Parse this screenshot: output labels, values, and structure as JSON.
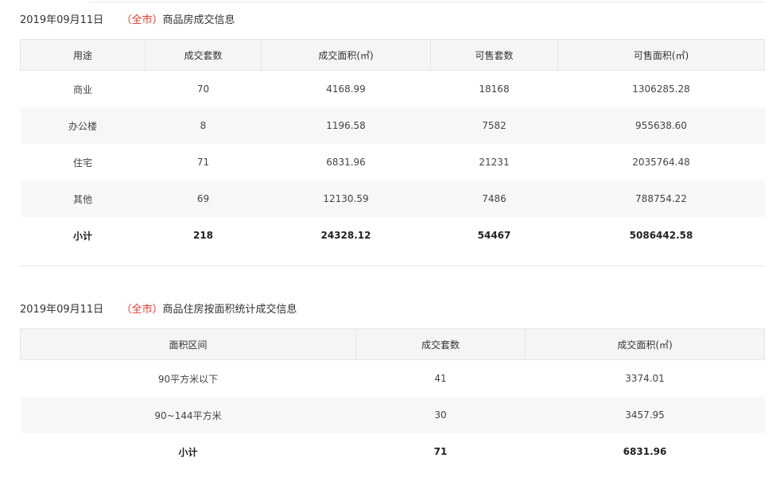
{
  "section1": {
    "date": "2019年09月11日",
    "open_paren": "（",
    "scope": "全市",
    "close_paren": "）",
    "title": "商品房成交信息",
    "headers": [
      "用途",
      "成交套数",
      "成交面积(㎡)",
      "可售套数",
      "可售面积(㎡)"
    ],
    "rows": [
      [
        "商业",
        "70",
        "4168.99",
        "18168",
        "1306285.28"
      ],
      [
        "办公楼",
        "8",
        "1196.58",
        "7582",
        "955638.60"
      ],
      [
        "住宅",
        "71",
        "6831.96",
        "21231",
        "2035764.48"
      ],
      [
        "其他",
        "69",
        "12130.59",
        "7486",
        "788754.22"
      ]
    ],
    "total": [
      "小计",
      "218",
      "24328.12",
      "54467",
      "5086442.58"
    ]
  },
  "section2": {
    "date": "2019年09月11日",
    "open_paren": "（",
    "scope": "全市",
    "close_paren": "）",
    "title": "商品住房按面积统计成交信息",
    "headers": [
      "面积区间",
      "成交套数",
      "成交面积(㎡)"
    ],
    "rows": [
      [
        "90平方米以下",
        "41",
        "3374.01"
      ],
      [
        "90~144平方米",
        "30",
        "3457.95"
      ]
    ],
    "total": [
      "小计",
      "71",
      "6831.96"
    ]
  },
  "colors": {
    "accent": "#e33b2c",
    "header_bg": "#f5f5f5",
    "alt_row_bg": "#f7f7f7"
  }
}
